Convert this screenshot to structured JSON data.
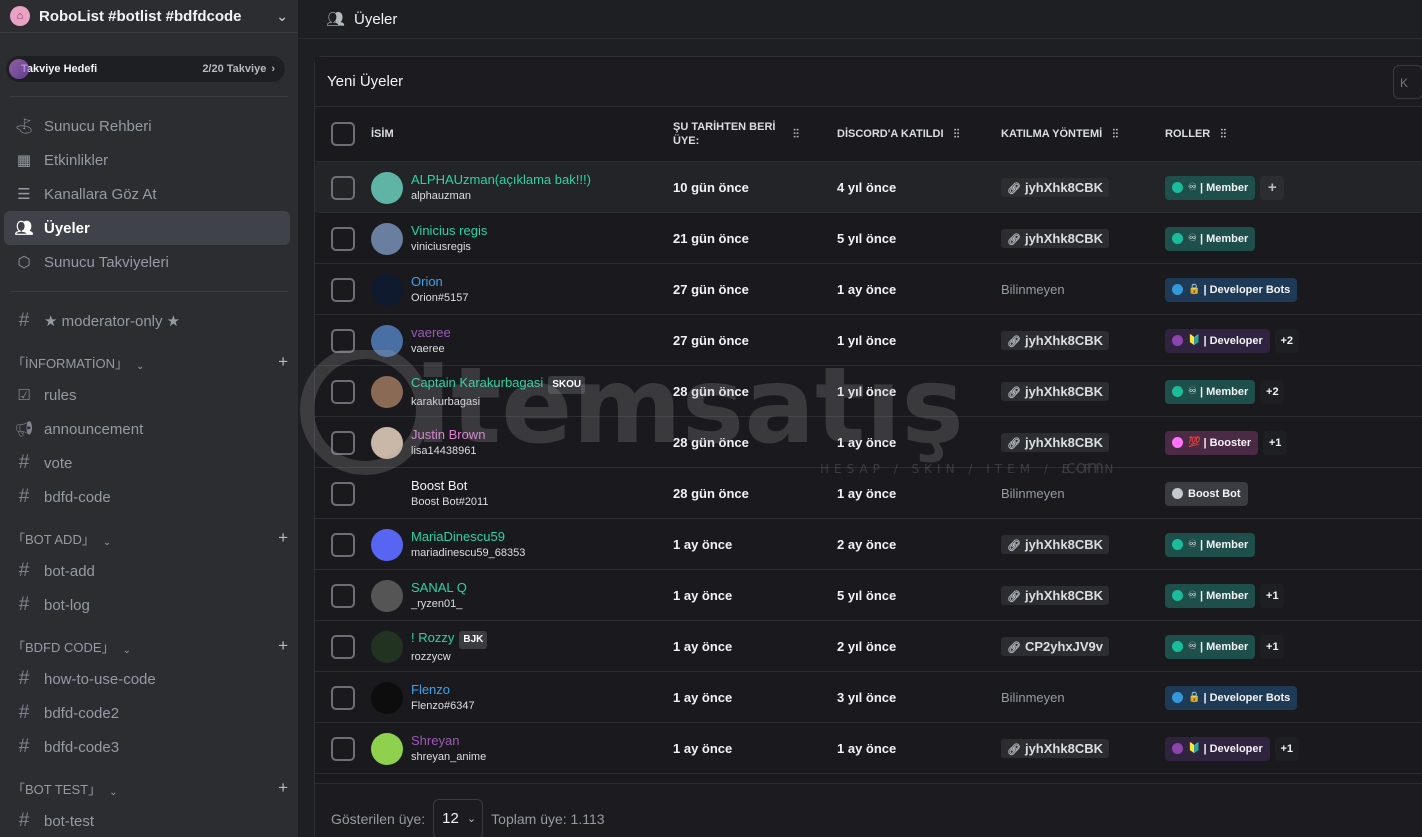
{
  "server": {
    "name": "RoboList #botlist #bdfdcode"
  },
  "boost": {
    "label": "Takviye Hedefi",
    "count": "2/20 Takviye"
  },
  "nav": [
    {
      "label": "Sunucu Rehberi",
      "icon": "signpost-icon"
    },
    {
      "label": "Etkinlikler",
      "icon": "calendar-icon"
    },
    {
      "label": "Kanallara Göz At",
      "icon": "browse-channels-icon"
    },
    {
      "label": "Üyeler",
      "icon": "members-icon",
      "active": true
    },
    {
      "label": "Sunucu Takviyeleri",
      "icon": "boost-icon"
    }
  ],
  "channels": {
    "top": "★ moderator-only ★",
    "cat1": {
      "name": "「İNFORMATİON」",
      "items": [
        "rules",
        "announcement",
        "vote",
        "bdfd-code"
      ]
    },
    "cat2": {
      "name": "「BOT ADD」",
      "items": [
        "bot-add",
        "bot-log"
      ]
    },
    "cat3": {
      "name": "「BDFD CODE」",
      "items": [
        "how-to-use-code",
        "bdfd-code2",
        "bdfd-code3"
      ]
    },
    "cat4": {
      "name": "「BOT TEST」",
      "items": [
        "bot-test"
      ]
    }
  },
  "header": {
    "title": "Üyeler"
  },
  "panel": {
    "title": "Yeni Üyeler",
    "search_hint": "K"
  },
  "columns": {
    "name": "İSİM",
    "member_since": "ŞU TARİHTEN BERİ ÜYE:",
    "joined_discord": "DİSCORD'A KATILDI",
    "join_method": "KATILMA YÖNTEMİ",
    "roles": "ROLLER"
  },
  "members": [
    {
      "name": "ALPHAUzman(açıklama bak!!!)",
      "handle": "alphauzman",
      "name_color": "#2dd4a0",
      "avatar_color": "#5fb4a6",
      "since": "10 gün önce",
      "joined": "4 yıl önce",
      "method": "jyhXhk8CBK",
      "role": "| Member",
      "role_dot": "#1abc9c",
      "role_bg": "#1f4f4a",
      "role_emoji": "♾",
      "extra": "+"
    },
    {
      "name": "Vinicius regis",
      "handle": "viniciusregis",
      "name_color": "#2dd4a0",
      "avatar_color": "#6a7fa0",
      "since": "21 gün önce",
      "joined": "5 yıl önce",
      "method": "jyhXhk8CBK",
      "role": "| Member",
      "role_dot": "#1abc9c",
      "role_bg": "#1f4f4a",
      "role_emoji": "♾",
      "extra": ""
    },
    {
      "name": "Orion",
      "handle": "Orion#5157",
      "name_color": "#3ba2f0",
      "avatar_color": "#0f1a2e",
      "since": "27 gün önce",
      "joined": "1 ay önce",
      "method": "Bilinmeyen",
      "role": "| Developer Bots",
      "role_dot": "#3498db",
      "role_bg": "#1f3a56",
      "role_emoji": "🔒",
      "extra": ""
    },
    {
      "name": "vaeree",
      "handle": "vaeree",
      "name_color": "#9b59b6",
      "avatar_color": "#4a6fa5",
      "since": "27 gün önce",
      "joined": "1 yıl önce",
      "method": "jyhXhk8CBK",
      "role": "| Developer",
      "role_dot": "#8e44ad",
      "role_bg": "#2f2340",
      "role_emoji": "🔰",
      "extra": "+2"
    },
    {
      "name": "Captain Karakurbagasi",
      "handle": "karakurbagasi",
      "name_color": "#2dd4a0",
      "avatar_color": "#8a6a55",
      "since": "28 gün önce",
      "joined": "1 yıl önce",
      "method": "jyhXhk8CBK",
      "role": "| Member",
      "role_dot": "#1abc9c",
      "role_bg": "#1f4f4a",
      "role_emoji": "♾",
      "extra": "+2",
      "tag": "SKOU"
    },
    {
      "name": "Justin Brown",
      "handle": "lisa14438961",
      "name_color": "#e07fd8",
      "avatar_color": "#c9b8a8",
      "since": "28 gün önce",
      "joined": "1 ay önce",
      "method": "jyhXhk8CBK",
      "role": "| Booster",
      "role_dot": "#ff73fa",
      "role_bg": "#4a2a45",
      "role_emoji": "💯",
      "extra": "+1"
    },
    {
      "name": "Boost Bot",
      "handle": "Boost Bot#2011",
      "name_color": "#f2f3f5",
      "avatar_color": "#1a1a1e",
      "since": "28 gün önce",
      "joined": "1 ay önce",
      "method": "Bilinmeyen",
      "role": "Boost Bot",
      "role_dot": "#c4c9ce",
      "role_bg": "#3a3c42",
      "role_emoji": "",
      "extra": ""
    },
    {
      "name": "MariaDinescu59",
      "handle": "mariadinescu59_68353",
      "name_color": "#2dd4a0",
      "avatar_color": "#5865f2",
      "since": "1 ay önce",
      "joined": "2 ay önce",
      "method": "jyhXhk8CBK",
      "role": "| Member",
      "role_dot": "#1abc9c",
      "role_bg": "#1f4f4a",
      "role_emoji": "♾",
      "extra": ""
    },
    {
      "name": "SANAL Q",
      "handle": "_ryzen01_",
      "name_color": "#2dd4a0",
      "avatar_color": "#555",
      "since": "1 ay önce",
      "joined": "5 yıl önce",
      "method": "jyhXhk8CBK",
      "role": "| Member",
      "role_dot": "#1abc9c",
      "role_bg": "#1f4f4a",
      "role_emoji": "♾",
      "extra": "+1"
    },
    {
      "name": "! Rozzy",
      "handle": "rozzycw",
      "name_color": "#2dd4a0",
      "avatar_color": "#223322",
      "since": "1 ay önce",
      "joined": "2 yıl önce",
      "method": "CP2yhxJV9v",
      "role": "| Member",
      "role_dot": "#1abc9c",
      "role_bg": "#1f4f4a",
      "role_emoji": "♾",
      "extra": "+1",
      "tag": "BJK"
    },
    {
      "name": "Flenzo",
      "handle": "Flenzo#6347",
      "name_color": "#3ba2f0",
      "avatar_color": "#0d0d0d",
      "since": "1 ay önce",
      "joined": "3 yıl önce",
      "method": "Bilinmeyen",
      "role": "| Developer Bots",
      "role_dot": "#3498db",
      "role_bg": "#1f3a56",
      "role_emoji": "🔒",
      "extra": ""
    },
    {
      "name": "Shreyan",
      "handle": "shreyan_anime",
      "name_color": "#9b59b6",
      "avatar_color": "#8fd14f",
      "since": "1 ay önce",
      "joined": "1 ay önce",
      "method": "jyhXhk8CBK",
      "role": "| Developer",
      "role_dot": "#8e44ad",
      "role_bg": "#2f2340",
      "role_emoji": "🔰",
      "extra": "+1"
    }
  ],
  "footer": {
    "shown_label": "Gösterilen üye:",
    "shown_value": "12",
    "total": "Toplam üye: 1.113"
  },
  "watermark": {
    "text": "itemsatış",
    "sub": "HESAP / SKIN / ITEM / E-PIN",
    "com": ".com"
  }
}
